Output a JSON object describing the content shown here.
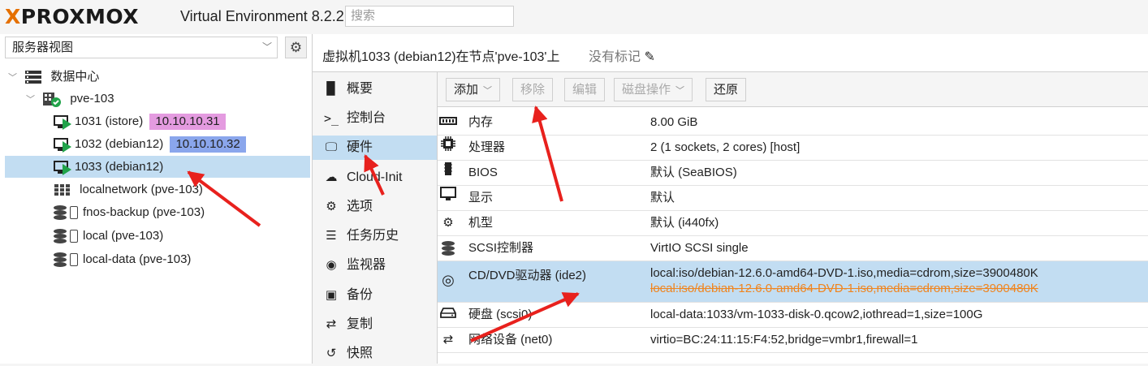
{
  "app": {
    "brand": "PROXMOX",
    "brand_x": "X",
    "title": "Virtual Environment 8.2.2",
    "search_placeholder": "搜索"
  },
  "sidebar": {
    "view_select": "服务器视图",
    "tree": [
      {
        "label": "数据中心"
      },
      {
        "label": "pve-103"
      },
      {
        "label": "1031 (istore)",
        "ip": "10.10.10.31",
        "ip_color": "#e49be0"
      },
      {
        "label": "1032 (debian12)",
        "ip": "10.10.10.32",
        "ip_color": "#8aa6ec"
      },
      {
        "label": "1033 (debian12)"
      },
      {
        "label": "localnetwork (pve-103)"
      },
      {
        "label": "fnos-backup (pve-103)"
      },
      {
        "label": "local (pve-103)"
      },
      {
        "label": "local-data (pve-103)"
      }
    ]
  },
  "header": {
    "title": "虚拟机1033 (debian12)在节点'pve-103'上",
    "tags": "没有标记"
  },
  "menu": [
    {
      "icon": "book-icon",
      "label": "概要"
    },
    {
      "icon": "terminal-icon",
      "label": "控制台"
    },
    {
      "icon": "desktop-icon",
      "label": "硬件"
    },
    {
      "icon": "cloud-icon",
      "label": "Cloud-Init"
    },
    {
      "icon": "gear-icon",
      "label": "选项"
    },
    {
      "icon": "list-icon",
      "label": "任务历史"
    },
    {
      "icon": "eye-icon",
      "label": "监视器"
    },
    {
      "icon": "floppy-icon",
      "label": "备份"
    },
    {
      "icon": "retweet-icon",
      "label": "复制"
    },
    {
      "icon": "history-icon",
      "label": "快照"
    }
  ],
  "toolbar": {
    "add": "添加",
    "remove": "移除",
    "edit": "编辑",
    "disk_action": "磁盘操作",
    "revert": "还原"
  },
  "hardware": [
    {
      "icon": "memory-icon",
      "key": "内存",
      "value": "8.00 GiB"
    },
    {
      "icon": "cpu-icon",
      "key": "处理器",
      "value": "2 (1 sockets, 2 cores) [host]"
    },
    {
      "icon": "bios-icon",
      "key": "BIOS",
      "value": "默认 (SeaBIOS)"
    },
    {
      "icon": "display-icon",
      "key": "显示",
      "value": "默认"
    },
    {
      "icon": "machine-icon",
      "key": "机型",
      "value": "默认 (i440fx)"
    },
    {
      "icon": "database-icon",
      "key": "SCSI控制器",
      "value": "VirtIO SCSI single"
    },
    {
      "icon": "cdrom-icon",
      "key": "CD/DVD驱动器 (ide2)",
      "value": "local:iso/debian-12.6.0-amd64-DVD-1.iso,media=cdrom,size=3900480K",
      "pending": "local:iso/debian-12.6.0-amd64-DVD-1.iso,media=cdrom,size=3900480K"
    },
    {
      "icon": "hdd-icon",
      "key": "硬盘 (scsi0)",
      "value": "local-data:1033/vm-1033-disk-0.qcow2,iothread=1,size=100G"
    },
    {
      "icon": "exchange-icon",
      "key": "网络设备 (net0)",
      "value": "virtio=BC:24:11:15:F4:52,bridge=vmbr1,firewall=1"
    }
  ],
  "colors": {
    "selection": "#c2ddf2",
    "brand_orange": "#e57000",
    "pending": "#f0851f",
    "arrow": "#e8211d",
    "running": "#21a34a"
  }
}
